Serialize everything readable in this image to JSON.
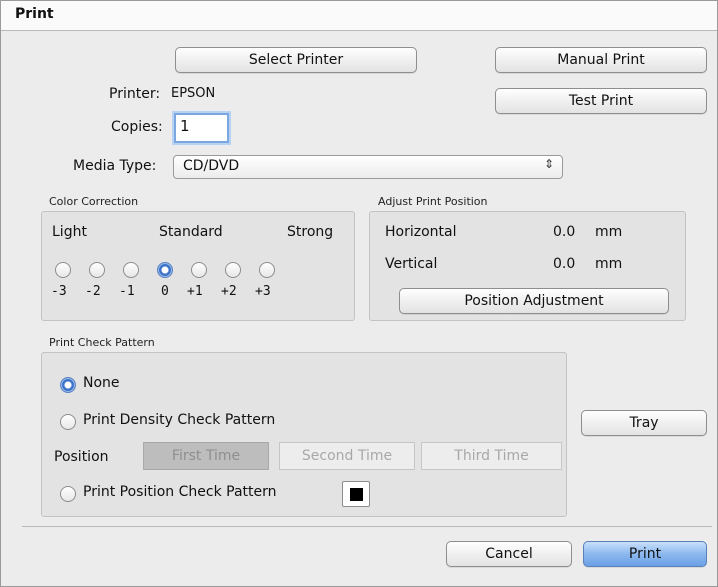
{
  "window": {
    "title": "Print"
  },
  "buttons": {
    "select_printer": "Select Printer",
    "manual_print": "Manual Print",
    "test_print": "Test Print",
    "position_adjustment": "Position Adjustment",
    "tray": "Tray",
    "cancel": "Cancel",
    "print": "Print"
  },
  "printer": {
    "label": "Printer:",
    "value": "EPSON"
  },
  "copies": {
    "label": "Copies:",
    "value": "1"
  },
  "media_type": {
    "label": "Media Type:",
    "value": "CD/DVD",
    "arrow": "⇕"
  },
  "color_correction": {
    "title": "Color Correction",
    "labels": {
      "light": "Light",
      "standard": "Standard",
      "strong": "Strong"
    },
    "values": [
      "-3",
      "-2",
      "-1",
      "0",
      "+1",
      "+2",
      "+3"
    ],
    "selected": "0"
  },
  "adjust_position": {
    "title": "Adjust Print Position",
    "horizontal": {
      "label": "Horizontal",
      "value": "0.0",
      "unit": "mm"
    },
    "vertical": {
      "label": "Vertical",
      "value": "0.0",
      "unit": "mm"
    }
  },
  "check_pattern": {
    "title": "Print Check Pattern",
    "options": {
      "none": "None",
      "density": "Print Density Check Pattern",
      "position": "Print Position Check Pattern"
    },
    "selected": "None",
    "position_label": "Position",
    "times": [
      "First Time",
      "Second Time",
      "Third Time"
    ],
    "selected_time": "First Time"
  },
  "colors": {
    "default_button": "#6aa0e6",
    "focus_ring": "#7aa7e0",
    "radio_selected": "#3d72c9"
  }
}
